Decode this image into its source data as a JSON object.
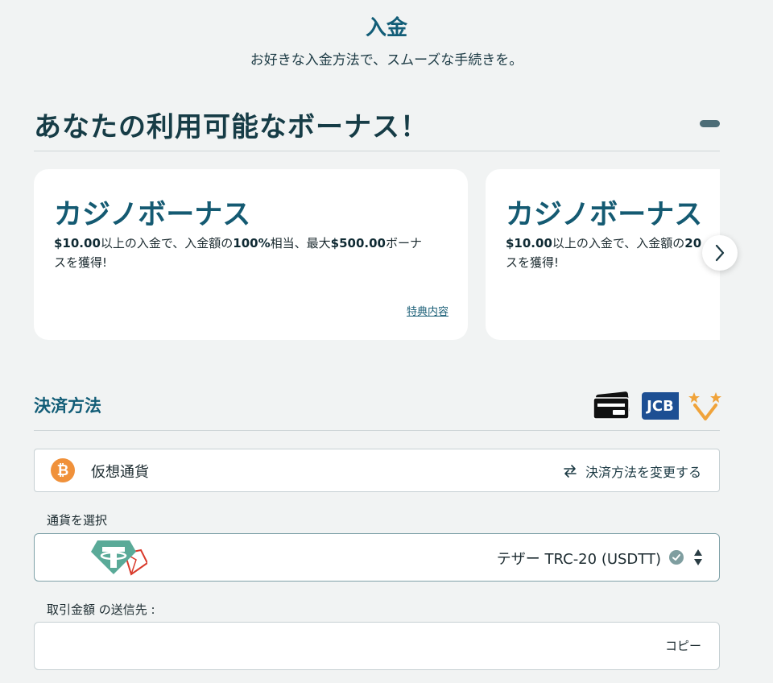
{
  "header": {
    "title": "入金",
    "subtitle": "お好きな入金方法で、スムーズな手続きを。"
  },
  "bonuses": {
    "heading": "あなたの利用可能なボーナス！",
    "collapse_icon": "minus-icon",
    "cards": [
      {
        "title": "カジノボーナス",
        "desc_parts": [
          "$10.00",
          "以上の入金で、入金額の",
          "100%",
          "相当、最大",
          "$500.00",
          "ボーナスを獲得!"
        ],
        "link": "特典内容"
      },
      {
        "title": "カジノボーナス",
        "desc_parts": [
          "$10.00",
          "以上の入金で、入金額の",
          "20",
          "",
          "",
          "スを獲得!"
        ],
        "link": ""
      }
    ],
    "next_icon": "chevron-right-icon"
  },
  "payment": {
    "section_title": "決済方法",
    "logos": [
      "card-icon",
      "jcb-logo",
      "star-v-logo"
    ],
    "jcb_text": "JCB",
    "method": {
      "icon": "bitcoin-icon",
      "icon_glyph": "₿",
      "label": "仮想通貨",
      "change_label": "決済方法を変更する",
      "change_icon": "swap-arrows-icon"
    },
    "currency": {
      "label": "通貨を選択",
      "value": "テザー TRC-20 (USDTT)",
      "icons": [
        "tether-tron-logo",
        "check-circle-icon",
        "sort-updown-icon"
      ],
      "tether_glyph": "T"
    },
    "address": {
      "label": "取引金額 の送信先 :",
      "value": "",
      "copy_label": "コピー"
    }
  },
  "colors": {
    "background": "#f1f3f3",
    "accent": "#125d77",
    "bitcoin": "#f0913a",
    "tether": "#5aaa98",
    "tron": "#d93a2b"
  }
}
